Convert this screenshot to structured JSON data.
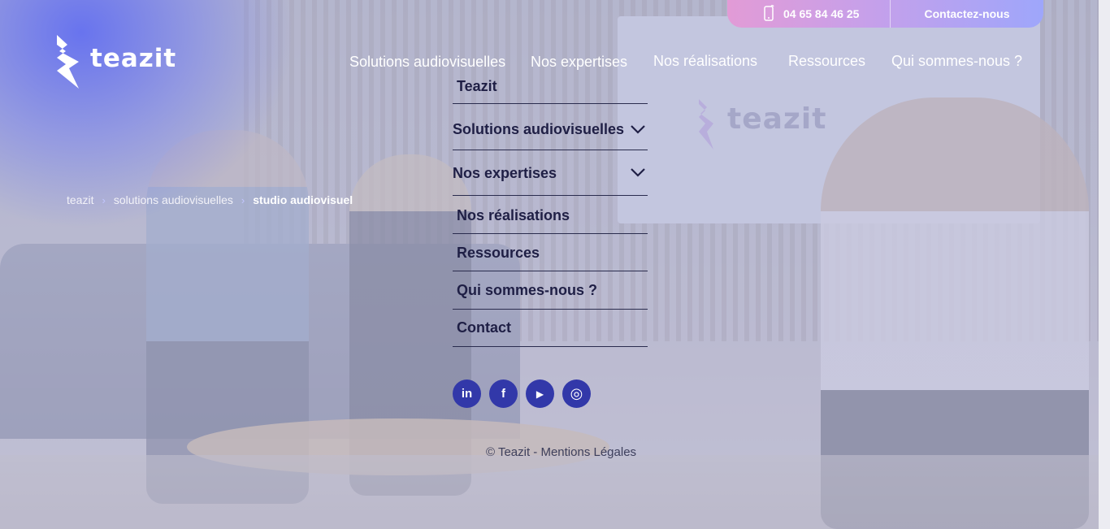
{
  "topbar": {
    "phone": "04 65 84 46 25",
    "contact_label": "Contactez-nous",
    "gradient": [
      "#e29bd6",
      "#9ea6fb"
    ]
  },
  "brand": {
    "name": "teazit",
    "accent": "#6d74f0"
  },
  "nav": {
    "items": [
      {
        "label": "Solutions audiovisuelles"
      },
      {
        "label": "Nos expertises"
      },
      {
        "label": "Nos réalisations"
      },
      {
        "label": "Ressources"
      },
      {
        "label": "Qui sommes-nous ?"
      }
    ]
  },
  "breadcrumb": {
    "home": "teazit",
    "parent": "solutions audiovisuelles",
    "current": "studio audiovisuel"
  },
  "menu": {
    "items": [
      {
        "label": "Teazit",
        "has_submenu": false
      },
      {
        "label": "Solutions audiovisuelles",
        "has_submenu": true
      },
      {
        "label": "Nos expertises",
        "has_submenu": true
      },
      {
        "label": "Nos réalisations",
        "has_submenu": false
      },
      {
        "label": "Ressources",
        "has_submenu": false
      },
      {
        "label": "Qui sommes-nous ?",
        "has_submenu": false
      },
      {
        "label": "Contact",
        "has_submenu": false
      }
    ],
    "social": [
      {
        "name": "linkedin-icon",
        "glyph": "in"
      },
      {
        "name": "facebook-icon",
        "glyph": "f"
      },
      {
        "name": "youtube-icon",
        "glyph": "▶"
      },
      {
        "name": "instagram-icon",
        "glyph": "◎"
      }
    ],
    "social_color": "#3238a9",
    "legal": "© Teazit - Mentions Légales"
  }
}
